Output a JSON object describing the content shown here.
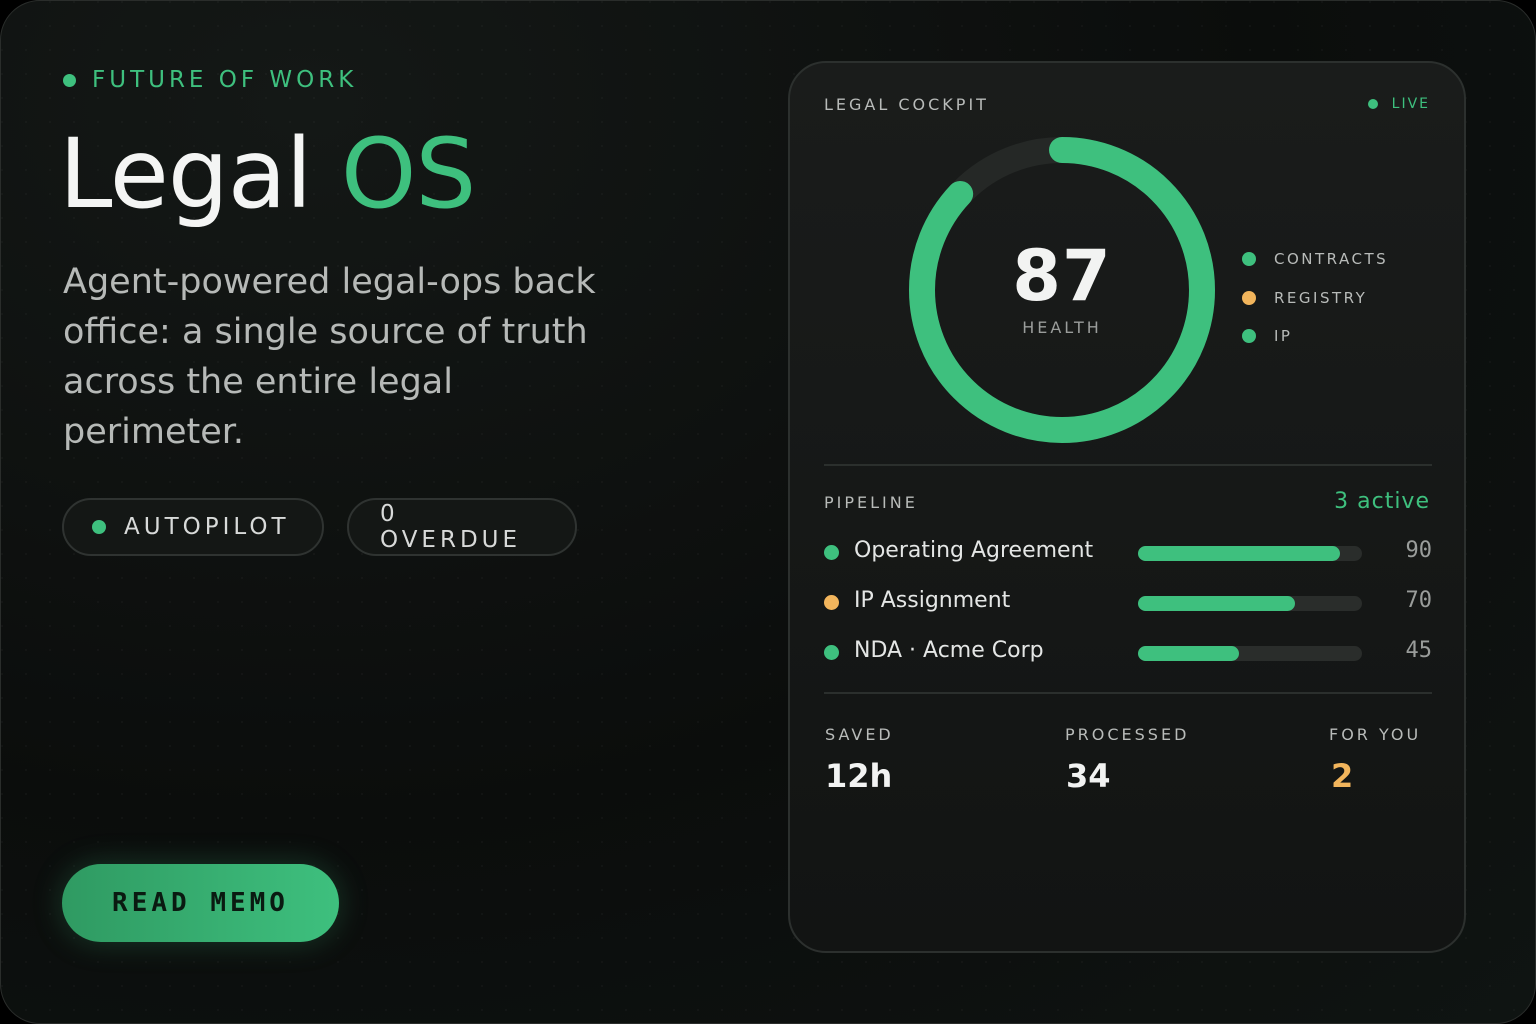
{
  "hero": {
    "kicker": "FUTURE OF WORK",
    "title_main": "Legal",
    "title_accent": "OS",
    "subtitle": "Agent-powered legal-ops back office: a single source of truth across the entire legal perimeter.",
    "pill_autopilot": "AUTOPILOT",
    "pill_overdue": "0 OVERDUE",
    "cta": "READ MEMO"
  },
  "cockpit": {
    "title": "LEGAL COCKPIT",
    "live": "LIVE",
    "health_value": "87",
    "health_label": "HEALTH",
    "health_fraction": 0.87,
    "legend": [
      {
        "label": "CONTRACTS",
        "color": "#3ec07e"
      },
      {
        "label": "REGISTRY",
        "color": "#f2b55c"
      },
      {
        "label": "IP",
        "color": "#3ec07e"
      }
    ],
    "pipeline": {
      "title": "PIPELINE",
      "active": "3 active",
      "rows": [
        {
          "name": "Operating Agreement",
          "value": "90",
          "level": 0.9,
          "color": "#3ec07e"
        },
        {
          "name": "IP Assignment",
          "value": "70",
          "level": 0.7,
          "color": "#f2b55c"
        },
        {
          "name": "NDA · Acme Corp",
          "value": "45",
          "level": 0.45,
          "color": "#3ec07e"
        }
      ]
    },
    "stats": [
      {
        "label": "SAVED",
        "value": "12h",
        "color": "#f2f3f2"
      },
      {
        "label": "PROCESSED",
        "value": "34",
        "color": "#f2f3f2"
      },
      {
        "label": "FOR YOU",
        "value": "2",
        "color": "#f2b55c"
      }
    ]
  },
  "colors": {
    "accent": "#3ec07e",
    "warning": "#f2b55c",
    "background": "#0b0d0c"
  }
}
